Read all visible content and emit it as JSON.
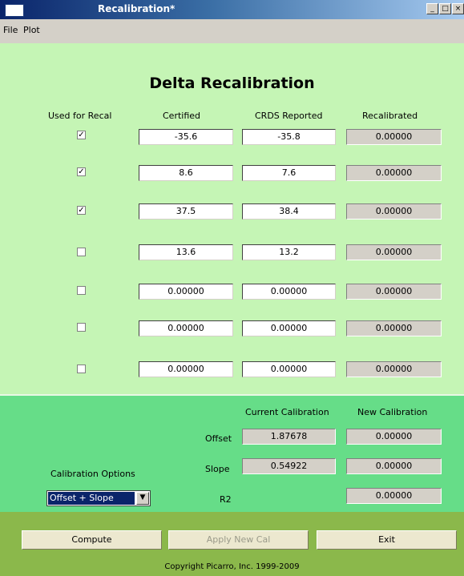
{
  "window": {
    "title": "Recalibration*",
    "minimize_label": "_",
    "maximize_label": "□",
    "close_label": "×"
  },
  "menu": [
    {
      "label": "File"
    },
    {
      "label": "Plot"
    }
  ],
  "heading": "Delta Recalibration",
  "columns": {
    "used": "Used for Recal",
    "certified": "Certified",
    "reported": "CRDS Reported",
    "recalibrated": "Recalibrated"
  },
  "rows": [
    {
      "used": true,
      "certified": "-35.6",
      "reported": "-35.8",
      "recalibrated": "0.00000"
    },
    {
      "used": true,
      "certified": "8.6",
      "reported": "7.6",
      "recalibrated": "0.00000"
    },
    {
      "used": true,
      "certified": "37.5",
      "reported": "38.4",
      "recalibrated": "0.00000"
    },
    {
      "used": false,
      "certified": "13.6",
      "reported": "13.2",
      "recalibrated": "0.00000"
    },
    {
      "used": false,
      "certified": "0.00000",
      "reported": "0.00000",
      "recalibrated": "0.00000"
    },
    {
      "used": false,
      "certified": "0.00000",
      "reported": "0.00000",
      "recalibrated": "0.00000"
    },
    {
      "used": false,
      "certified": "0.00000",
      "reported": "0.00000",
      "recalibrated": "0.00000"
    }
  ],
  "check_mark": "✓",
  "calibration": {
    "current_header": "Current Calibration",
    "new_header": "New Calibration",
    "offset_label": "Offset",
    "slope_label": "Slope",
    "r2_label": "R2",
    "current_offset": "1.87678",
    "current_slope": "0.54922",
    "new_offset": "0.00000",
    "new_slope": "0.00000",
    "new_r2": "0.00000"
  },
  "options": {
    "label": "Calibration Options",
    "selected": "Offset + Slope",
    "arrow": "▼"
  },
  "buttons": {
    "compute": "Compute",
    "apply": "Apply New Cal",
    "exit": "Exit"
  },
  "copyright": "Copyright Picarro, Inc. 1999-2009",
  "colors": {
    "upper_panel": "#c5f5b5",
    "lower_panel": "#66dd88",
    "footer": "#8bb84b",
    "title_start": "#0a246a",
    "selection": "#0a246a"
  }
}
